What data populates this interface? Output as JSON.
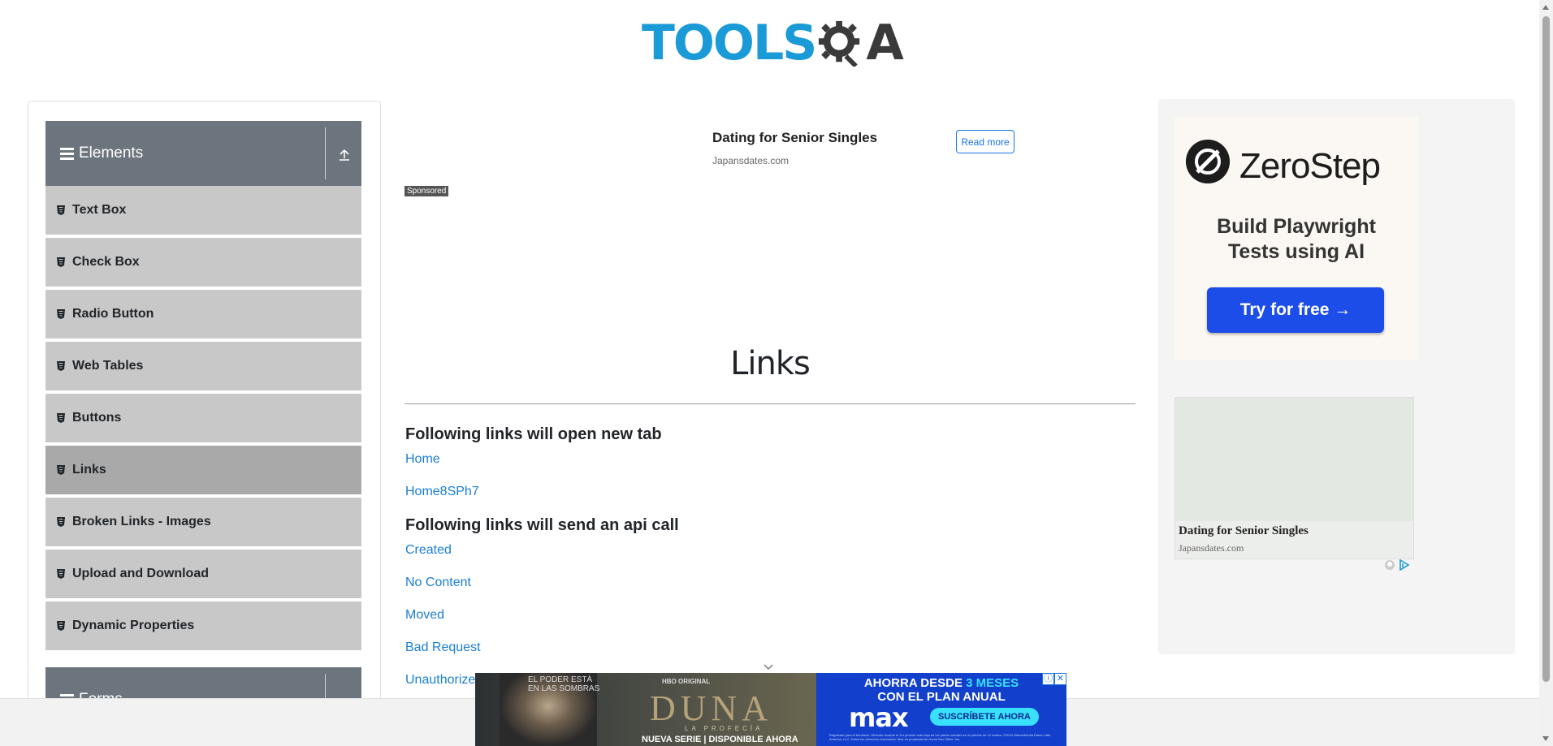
{
  "header": {
    "logo_text_tools": "TOOLS",
    "logo_text_qa": "A",
    "brand_blue": "#1a9ad6",
    "brand_dark": "#3a3a3a"
  },
  "sidebar": {
    "elements_group": {
      "label": "Elements",
      "icon": "hamburger-icon",
      "toggle_icon": "upload-arrow-icon"
    },
    "items": [
      {
        "label": "Text Box"
      },
      {
        "label": "Check Box"
      },
      {
        "label": "Radio Button"
      },
      {
        "label": "Web Tables"
      },
      {
        "label": "Buttons"
      },
      {
        "label": "Links",
        "active": true
      },
      {
        "label": "Broken Links - Images"
      },
      {
        "label": "Upload and Download"
      },
      {
        "label": "Dynamic Properties"
      }
    ],
    "forms_group": {
      "label": "Forms"
    },
    "colors": {
      "group_bg": "#6c757d",
      "item_bg": "#c8c8c8",
      "active_bg": "#a9a9a9"
    }
  },
  "top_ad": {
    "title": "Dating for Senior Singles",
    "domain": "Japansdates.com",
    "button": "Read more",
    "sponsored": "Sponsored"
  },
  "main": {
    "title": "Links",
    "section1": "Following links will open new tab",
    "links1": [
      "Home",
      "Home8SPh7"
    ],
    "section2": "Following links will send an api call",
    "links2": [
      "Created",
      "No Content",
      "Moved",
      "Bad Request",
      "Unauthorized"
    ],
    "link_color": "#1a7ed5"
  },
  "right_ad": {
    "brand": "ZeroStep",
    "headline_line1": "Build Playwright",
    "headline_line2": "Tests using AI",
    "cta": "Try for free →",
    "cta_color": "#1c4de8",
    "ad2_title": "Dating for Senior Singles",
    "ad2_domain": "Japansdates.com"
  },
  "bottom_ad": {
    "tagline_line1": "EL PODER ESTÁ",
    "tagline_line2": "EN LAS SOMBRAS",
    "brand": "HBO ORIGINAL",
    "title": "DUNA",
    "subtitle": "LA PROFECÍA",
    "serie": "NUEVA SERIE | DISPONIBLE AHORA",
    "promo_line1_a": "AHORRA DESDE ",
    "promo_line1_b": "3 MESES",
    "promo_line2": "CON EL PLAN ANUAL",
    "max": "max",
    "cta": "SUSCRÍBETE AHORA",
    "fine_print": "Regístrate para el beneficio. Ofrecido durante el 1er periodo más bajo de los planes anuales en el periodo de 12 meses. ©2024 WarnerMedia Direct Latin America, LLC. Todos los derechos reservados. Max es propiedad de Home Box Office, Inc."
  }
}
